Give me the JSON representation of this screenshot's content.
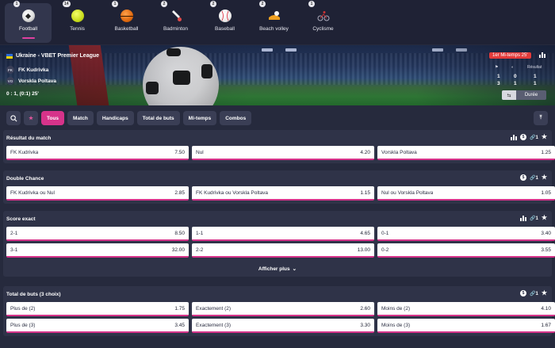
{
  "sports": [
    {
      "label": "Football",
      "count": "1",
      "icon": "football-icon",
      "active": true
    },
    {
      "label": "Tennis",
      "count": "14",
      "icon": "tennis-icon",
      "active": false
    },
    {
      "label": "Basketball",
      "count": "1",
      "icon": "basketball-icon",
      "active": false
    },
    {
      "label": "Badminton",
      "count": "2",
      "icon": "badminton-icon",
      "active": false
    },
    {
      "label": "Baseball",
      "count": "2",
      "icon": "baseball-icon",
      "active": false
    },
    {
      "label": "Beach volley",
      "count": "2",
      "icon": "beach-volley-icon",
      "active": false
    },
    {
      "label": "Cyclisme",
      "count": "1",
      "icon": "cycling-icon",
      "active": false
    }
  ],
  "match": {
    "league": "Ukraine - VBET Premier League",
    "team1": "FK Kudrivka",
    "team1_abbr": "FK",
    "team2": "Vorskla Poltava",
    "team2_abbr": "VO",
    "score_line": "0 : 1, (0:1) 25'",
    "period_badge": "1er Mi-temps 25'",
    "result_header": "Résultat",
    "stats_team1": [
      "1",
      "0",
      "1"
    ],
    "stats_team2": [
      "3",
      "1",
      "1"
    ],
    "duree_label": "Durée"
  },
  "filters": [
    {
      "label": "Tous",
      "active": true
    },
    {
      "label": "Match",
      "active": false
    },
    {
      "label": "Handicaps",
      "active": false
    },
    {
      "label": "Total de buts",
      "active": false
    },
    {
      "label": "Mi-temps",
      "active": false
    },
    {
      "label": "Combos",
      "active": false
    }
  ],
  "markets": {
    "result": {
      "title": "Résultat du match",
      "link_count": "1",
      "odds": [
        {
          "name": "FK Kudrivka",
          "value": "7.50"
        },
        {
          "name": "Nul",
          "value": "4.20"
        },
        {
          "name": "Vorskla Poltava",
          "value": "1.25"
        }
      ]
    },
    "double_chance": {
      "title": "Double Chance",
      "link_count": "1",
      "odds": [
        {
          "name": "FK Kudrivka ou Nul",
          "value": "2.85"
        },
        {
          "name": "FK Kudrivka ou Vorskla Poltava",
          "value": "1.15"
        },
        {
          "name": "Nul ou Vorskla Poltava",
          "value": "1.05"
        }
      ]
    },
    "exact_score": {
      "title": "Score exact",
      "link_count": "1",
      "odds": [
        {
          "name": "2-1",
          "value": "8.50"
        },
        {
          "name": "1-1",
          "value": "4.65"
        },
        {
          "name": "0-1",
          "value": "3.40"
        },
        {
          "name": "3-1",
          "value": "32.00"
        },
        {
          "name": "2-2",
          "value": "13.00"
        },
        {
          "name": "0-2",
          "value": "3.55"
        }
      ],
      "show_more": "Afficher plus"
    },
    "total_goals": {
      "title": "Total de buts (3 choix)",
      "link_count": "1",
      "odds": [
        {
          "name": "Plus de (2)",
          "value": "1.75"
        },
        {
          "name": "Exactement (2)",
          "value": "2.60"
        },
        {
          "name": "Moins de (2)",
          "value": "4.10"
        },
        {
          "name": "Plus de (3)",
          "value": "3.45"
        },
        {
          "name": "Exactement (3)",
          "value": "3.30"
        },
        {
          "name": "Moins de (3)",
          "value": "1.67"
        }
      ]
    }
  },
  "colors": {
    "accent": "#d6338a",
    "live": "#e23b3b",
    "page_bg": "#262a3d",
    "panel_bg": "#2f3348"
  }
}
